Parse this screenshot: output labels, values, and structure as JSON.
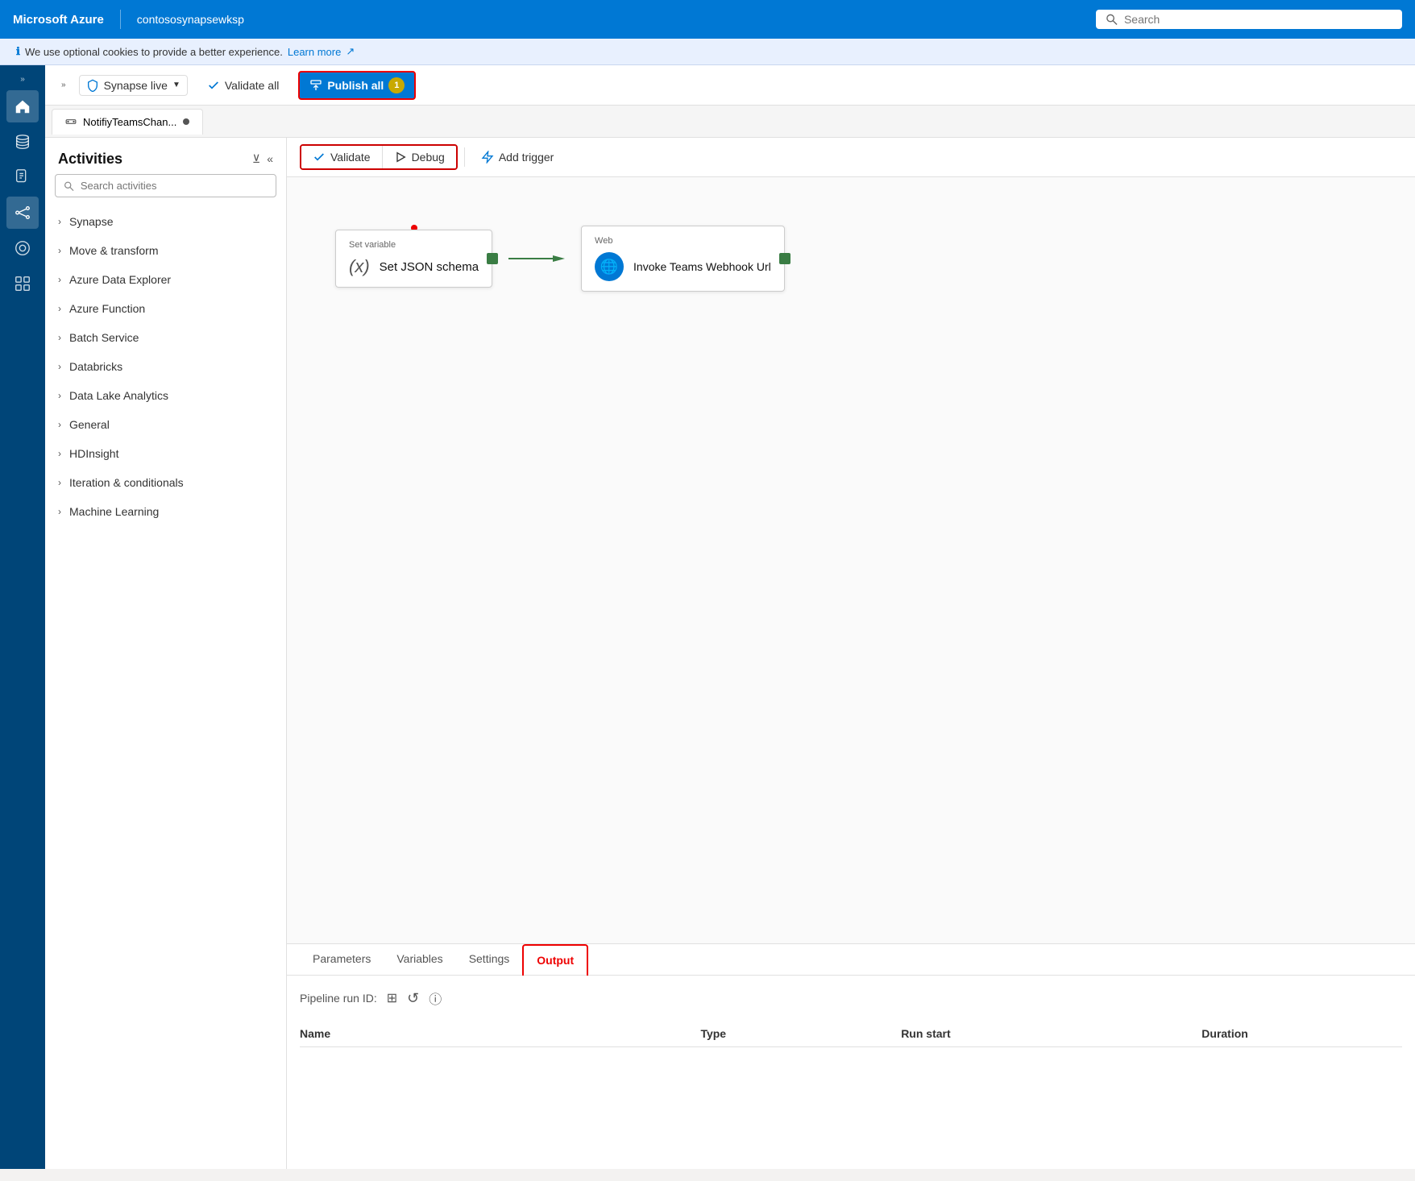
{
  "topbar": {
    "brand": "Microsoft Azure",
    "workspace": "contososynapsewksp",
    "search_placeholder": "Search"
  },
  "cookie_banner": {
    "text": "We use optional cookies to provide a better experience.",
    "link_text": "Learn more",
    "icon": "ℹ"
  },
  "toolbar": {
    "synapse_live_label": "Synapse live",
    "validate_all_label": "Validate all",
    "publish_all_label": "Publish all",
    "publish_badge": "1"
  },
  "tab": {
    "name": "NotifiyTeamsChan...",
    "dot_visible": true
  },
  "pipeline_toolbar": {
    "validate_label": "Validate",
    "debug_label": "Debug",
    "add_trigger_label": "Add trigger"
  },
  "activities": {
    "title": "Activities",
    "search_placeholder": "Search activities",
    "items": [
      {
        "label": "Synapse"
      },
      {
        "label": "Move & transform"
      },
      {
        "label": "Azure Data Explorer"
      },
      {
        "label": "Azure Function"
      },
      {
        "label": "Batch Service"
      },
      {
        "label": "Databricks"
      },
      {
        "label": "Data Lake Analytics"
      },
      {
        "label": "General"
      },
      {
        "label": "HDInsight"
      },
      {
        "label": "Iteration & conditionals"
      },
      {
        "label": "Machine Learning"
      }
    ]
  },
  "nodes": {
    "node1": {
      "header": "Set variable",
      "label": "Set JSON schema",
      "icon": "(x)"
    },
    "node2": {
      "header": "Web",
      "label": "Invoke Teams Webhook Url",
      "icon": "🌐"
    }
  },
  "bottom": {
    "tabs": [
      {
        "label": "Parameters"
      },
      {
        "label": "Variables"
      },
      {
        "label": "Settings"
      },
      {
        "label": "Output",
        "active": true
      }
    ],
    "pipeline_run_label": "Pipeline run ID:",
    "table_headers": {
      "name": "Name",
      "type": "Type",
      "run_start": "Run start",
      "duration": "Duration"
    }
  },
  "left_nav": {
    "icons": [
      {
        "name": "home-icon",
        "symbol": "⌂",
        "active": true
      },
      {
        "name": "database-icon",
        "symbol": "🗄",
        "active": false
      },
      {
        "name": "document-icon",
        "symbol": "📄",
        "active": false
      },
      {
        "name": "integration-icon",
        "symbol": "⬡",
        "active": false
      },
      {
        "name": "monitor-icon",
        "symbol": "◎",
        "active": false
      },
      {
        "name": "manage-icon",
        "symbol": "💼",
        "active": false
      }
    ]
  },
  "colors": {
    "accent": "#0078d4",
    "danger": "#cc0000",
    "success": "#3a7d44",
    "badge_bg": "#c8a900"
  }
}
